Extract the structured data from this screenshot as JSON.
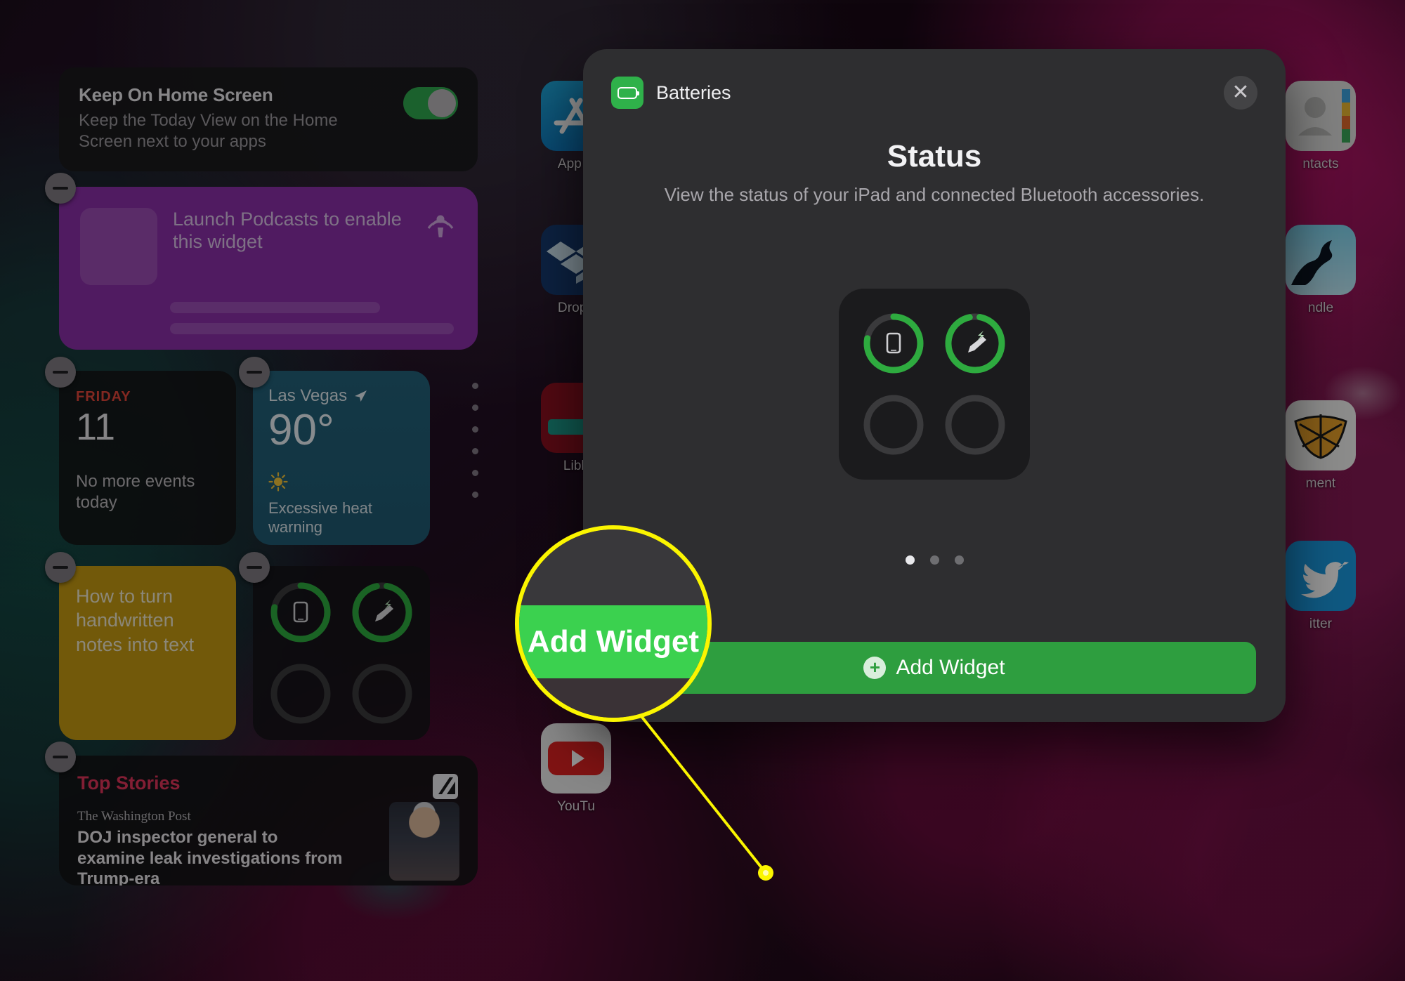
{
  "home": {
    "app_icons_left": [
      {
        "label": "App S",
        "icon": "app-store-icon"
      },
      {
        "label": "Dropb",
        "icon": "dropbox-icon"
      },
      {
        "label": "Libb",
        "icon": "libby-icon"
      },
      {
        "label": "YouTu",
        "icon": "youtube-icon"
      }
    ],
    "app_icons_right": [
      {
        "label": "ntacts",
        "icon": "contacts-icon"
      },
      {
        "label": "ndle",
        "icon": "kindle-icon"
      },
      {
        "label": "ment",
        "icon": "pigment-icon"
      },
      {
        "label": "itter",
        "icon": "twitter-icon"
      }
    ]
  },
  "today_view": {
    "keep_on_home": {
      "title": "Keep On Home Screen",
      "description": "Keep the Today View on the Home Screen next to your apps",
      "toggle_on": true
    },
    "podcasts_widget": {
      "message": "Launch Podcasts to enable this widget",
      "icon": "podcasts-icon"
    },
    "calendar_widget": {
      "weekday": "FRIDAY",
      "date": "11",
      "status": "No more events today"
    },
    "weather_widget": {
      "city": "Las Vegas",
      "location_icon": "location-arrow-icon",
      "temperature": "90°",
      "condition_icon": "sun-icon",
      "alert": "Excessive heat warning"
    },
    "notes_widget": {
      "text": "How to turn handwritten notes into text"
    },
    "batteries_widget": {
      "icon": "batteries-icon",
      "rings": [
        {
          "name": "ipad",
          "level": 78,
          "charging": false,
          "icon": "ipad-icon"
        },
        {
          "name": "apple-pencil",
          "level": 94,
          "charging": true,
          "icon": "pencil-icon"
        },
        {
          "name": "empty-slot-1",
          "level": 0,
          "charging": false,
          "icon": ""
        },
        {
          "name": "empty-slot-2",
          "level": 0,
          "charging": false,
          "icon": ""
        }
      ]
    },
    "news_widget": {
      "section": "Top Stories",
      "app_icon": "news-icon",
      "source": "The Washington Post",
      "headline": "DOJ inspector general to examine leak investigations from Trump-era"
    },
    "remove_button_label": "−"
  },
  "dialog": {
    "app_name": "Batteries",
    "app_icon": "battery-icon",
    "close_icon": "close-icon",
    "title": "Status",
    "subtitle": "View the status of your iPad and connected Bluetooth accessories.",
    "page_dots": {
      "count": 3,
      "active_index": 0
    },
    "add_button": {
      "label": "Add Widget",
      "icon": "plus-circle-icon"
    },
    "preview_rings": [
      {
        "name": "ipad",
        "level": 78,
        "charging": false,
        "icon": "ipad-icon"
      },
      {
        "name": "apple-pencil",
        "level": 94,
        "charging": true,
        "icon": "pencil-icon"
      },
      {
        "name": "empty-slot-1",
        "level": 0,
        "charging": false,
        "icon": ""
      },
      {
        "name": "empty-slot-2",
        "level": 0,
        "charging": false,
        "icon": ""
      }
    ]
  },
  "callout": {
    "magnified_label": "Add Widget",
    "highlight_color": "#fbf500",
    "button_color": "#3bd14f"
  },
  "colors": {
    "accent_green": "#2e9e3f",
    "bright_green": "#3bd14f",
    "callout_yellow": "#fbf500",
    "news_red": "#e0345a",
    "calendar_red": "#e0453a",
    "notes_yellow": "#c49a12",
    "podcasts_purple": "#8b2fa8",
    "weather_blue": "#236179"
  }
}
